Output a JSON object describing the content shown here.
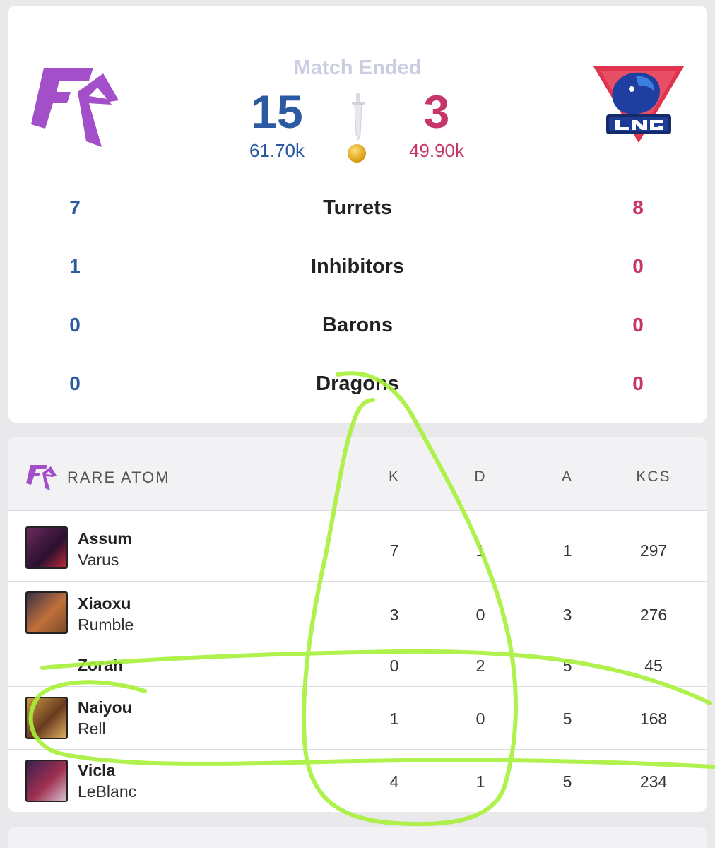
{
  "match": {
    "status": "Match Ended",
    "left_team": {
      "score": "15",
      "gold": "61.70k",
      "color": "#2b5aa2"
    },
    "right_team": {
      "score": "3",
      "gold": "49.90k",
      "color": "#c6366b"
    }
  },
  "objectives": [
    {
      "label": "Turrets",
      "left": "7",
      "right": "8"
    },
    {
      "label": "Inhibitors",
      "left": "1",
      "right": "0"
    },
    {
      "label": "Barons",
      "left": "0",
      "right": "0"
    },
    {
      "label": "Dragons",
      "left": "0",
      "right": "0"
    }
  ],
  "stats_table": {
    "team_name": "RARE ATOM",
    "columns": [
      "K",
      "D",
      "A",
      "KCS"
    ],
    "players": [
      {
        "player": "Assum",
        "champion": "Varus",
        "k": "7",
        "d": "1",
        "a": "1",
        "kcs": "297"
      },
      {
        "player": "Xiaoxu",
        "champion": "Rumble",
        "k": "3",
        "d": "0",
        "a": "3",
        "kcs": "276"
      },
      {
        "player": "Zorah",
        "champion": "",
        "k": "0",
        "d": "2",
        "a": "5",
        "kcs": "45"
      },
      {
        "player": "Naiyou",
        "champion": "Rell",
        "k": "1",
        "d": "0",
        "a": "5",
        "kcs": "168"
      },
      {
        "player": "Vicla",
        "champion": "LeBlanc",
        "k": "4",
        "d": "1",
        "a": "5",
        "kcs": "234"
      }
    ]
  },
  "colors": {
    "accent_blue": "#2b5aa2",
    "accent_red": "#c6366b",
    "rare_atom_purple": "#a24fc9",
    "scribble_green": "#a7f03a"
  },
  "icons": [
    "rare-atom-logo",
    "lng-esports-logo",
    "sword-icon",
    "gold-coin-icon"
  ]
}
